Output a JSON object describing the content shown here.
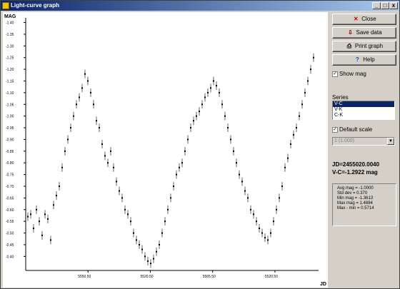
{
  "window": {
    "title": "Light-curve graph",
    "min_label": "_",
    "max_label": "□",
    "close_label": "x"
  },
  "buttons": {
    "close": {
      "label": "Close",
      "icon": "close-icon"
    },
    "save": {
      "label": "Save data",
      "icon": "save-icon"
    },
    "print": {
      "label": "Print graph",
      "icon": "printer-icon"
    },
    "help": {
      "label": "Help",
      "icon": "help-icon"
    }
  },
  "options": {
    "show_mag_label": "Show mag",
    "series_label": "Series",
    "series_items": [
      "V-C",
      "V-K",
      "C-K"
    ],
    "selected_series": 0,
    "default_scale_label": "Default scale",
    "scale_select_value": "1 (1.000)"
  },
  "readout": {
    "jd": "JD=2455020.0040",
    "mag": "V-C=-1.2922 mag"
  },
  "stats": {
    "avg": "Avg mag = -1.0000",
    "std": "Std dev = 0.370",
    "min": "Min mag = -1.3613",
    "max": "Max mag = 1.4884",
    "range": "Max - min = 0.5714"
  },
  "chart_data": {
    "type": "scatter",
    "ylabel": "MAG",
    "xlabel": "JD",
    "y_ticks": [
      "-1.40",
      "-1.35",
      "-1.30",
      "-1.25",
      "-1.20",
      "-1.15",
      "-1.10",
      "-1.05",
      "-1.00",
      "-0.95",
      "-0.90",
      "-0.85",
      "-0.80",
      "-0.75",
      "-0.70",
      "-0.65",
      "-0.60",
      "-0.55",
      "-0.50",
      "-0.45",
      "-0.40"
    ],
    "x_ticks": [
      "5550.50",
      "5520.50",
      "5565.50",
      "5520.50"
    ],
    "ylim": [
      -1.42,
      -0.34
    ],
    "series": [
      {
        "name": "V-C",
        "points": [
          [
            0.0,
            -0.57
          ],
          [
            0.02,
            -0.58
          ],
          [
            0.04,
            -0.52
          ],
          [
            0.06,
            -0.6
          ],
          [
            0.08,
            -0.55
          ],
          [
            0.1,
            -0.49
          ],
          [
            0.12,
            -0.58
          ],
          [
            0.14,
            -0.56
          ],
          [
            0.16,
            -0.47
          ],
          [
            0.18,
            -0.62
          ],
          [
            0.2,
            -0.66
          ],
          [
            0.22,
            -0.7
          ],
          [
            0.24,
            -0.78
          ],
          [
            0.26,
            -0.85
          ],
          [
            0.28,
            -0.9
          ],
          [
            0.3,
            -0.95
          ],
          [
            0.32,
            -1.0
          ],
          [
            0.34,
            -1.05
          ],
          [
            0.36,
            -1.08
          ],
          [
            0.38,
            -1.12
          ],
          [
            0.4,
            -1.18
          ],
          [
            0.42,
            -1.15
          ],
          [
            0.44,
            -1.1
          ],
          [
            0.46,
            -1.05
          ],
          [
            0.48,
            -0.98
          ],
          [
            0.5,
            -0.95
          ],
          [
            0.52,
            -0.88
          ],
          [
            0.54,
            -0.83
          ],
          [
            0.56,
            -0.8
          ],
          [
            0.58,
            -0.85
          ],
          [
            0.6,
            -0.78
          ],
          [
            0.62,
            -0.72
          ],
          [
            0.64,
            -0.68
          ],
          [
            0.66,
            -0.65
          ],
          [
            0.68,
            -0.6
          ],
          [
            0.7,
            -0.58
          ],
          [
            0.72,
            -0.55
          ],
          [
            0.74,
            -0.5
          ],
          [
            0.76,
            -0.47
          ],
          [
            0.78,
            -0.45
          ],
          [
            0.8,
            -0.43
          ],
          [
            0.82,
            -0.4
          ],
          [
            0.84,
            -0.38
          ],
          [
            0.86,
            -0.37
          ],
          [
            0.88,
            -0.39
          ],
          [
            0.9,
            -0.42
          ],
          [
            0.92,
            -0.45
          ],
          [
            0.94,
            -0.5
          ],
          [
            0.96,
            -0.55
          ],
          [
            0.98,
            -0.6
          ],
          [
            1.0,
            -0.65
          ],
          [
            1.02,
            -0.7
          ],
          [
            1.04,
            -0.75
          ],
          [
            1.06,
            -0.78
          ],
          [
            1.08,
            -0.8
          ],
          [
            1.1,
            -0.85
          ],
          [
            1.12,
            -0.9
          ],
          [
            1.14,
            -0.95
          ],
          [
            1.16,
            -0.98
          ],
          [
            1.18,
            -1.0
          ],
          [
            1.2,
            -1.02
          ],
          [
            1.22,
            -1.05
          ],
          [
            1.24,
            -1.08
          ],
          [
            1.26,
            -1.1
          ],
          [
            1.28,
            -1.12
          ],
          [
            1.3,
            -1.15
          ],
          [
            1.32,
            -1.13
          ],
          [
            1.34,
            -1.1
          ],
          [
            1.36,
            -1.05
          ],
          [
            1.38,
            -1.0
          ],
          [
            1.4,
            -0.95
          ],
          [
            1.42,
            -0.9
          ],
          [
            1.44,
            -0.85
          ],
          [
            1.46,
            -0.8
          ],
          [
            1.48,
            -0.75
          ],
          [
            1.5,
            -0.72
          ],
          [
            1.52,
            -0.68
          ],
          [
            1.54,
            -0.65
          ],
          [
            1.56,
            -0.6
          ],
          [
            1.58,
            -0.58
          ],
          [
            1.6,
            -0.55
          ],
          [
            1.62,
            -0.52
          ],
          [
            1.64,
            -0.5
          ],
          [
            1.66,
            -0.48
          ],
          [
            1.68,
            -0.47
          ],
          [
            1.7,
            -0.5
          ],
          [
            1.72,
            -0.55
          ],
          [
            1.74,
            -0.6
          ],
          [
            1.76,
            -0.65
          ],
          [
            1.78,
            -0.7
          ],
          [
            1.8,
            -0.78
          ],
          [
            1.82,
            -0.82
          ],
          [
            1.84,
            -0.88
          ],
          [
            1.86,
            -0.92
          ],
          [
            1.88,
            -0.95
          ],
          [
            1.9,
            -1.0
          ],
          [
            1.92,
            -1.05
          ],
          [
            1.94,
            -1.1
          ],
          [
            1.96,
            -1.15
          ],
          [
            1.98,
            -1.2
          ],
          [
            2.0,
            -1.25
          ]
        ]
      }
    ]
  }
}
